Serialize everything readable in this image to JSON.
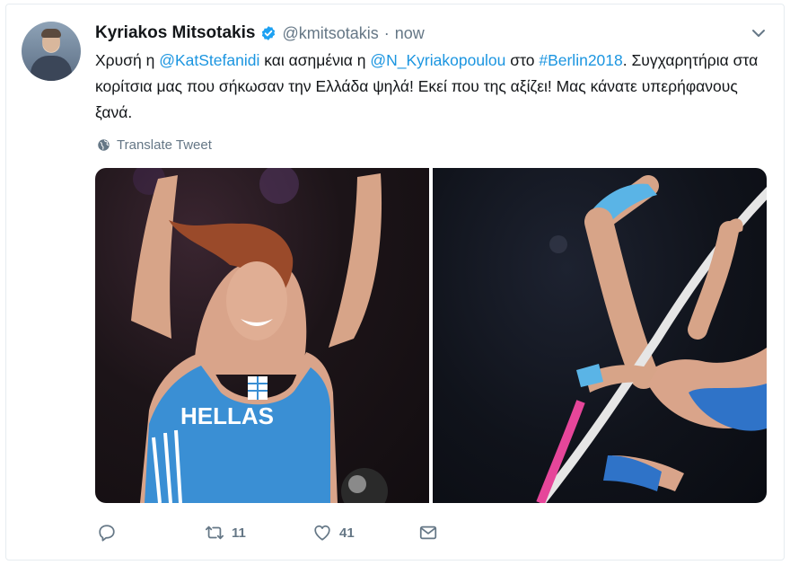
{
  "tweet": {
    "author_name": "Kyriakos Mitsotakis",
    "handle": "@kmitsotakis",
    "separator": "·",
    "time": "now",
    "text_1": "Χρυσή η ",
    "mention_1": "@KatStefanidi",
    "text_2": " και ασημένια η ",
    "mention_2": "@N_Kyriakopoulou",
    "text_3": " στο ",
    "hashtag": "#Berlin2018",
    "text_4": ". Συγχαρητήρια στα κορίτσια μας που σήκωσαν την Ελλάδα ψηλά! Εκεί που της αξίζει! Μας κάνατε υπερήφανους ξανά.",
    "translate_label": "Translate Tweet",
    "jersey_text": "HELLAS"
  },
  "actions": {
    "retweet_count": "11",
    "like_count": "41"
  },
  "colors": {
    "link": "#1b95e0",
    "muted": "#657786",
    "verified": "#1da1f2"
  },
  "icons": {
    "verified": "verified-badge-icon",
    "chevron": "chevron-down-icon",
    "globe": "globe-icon",
    "reply": "reply-icon",
    "retweet": "retweet-icon",
    "like": "heart-icon",
    "dm": "envelope-icon"
  }
}
